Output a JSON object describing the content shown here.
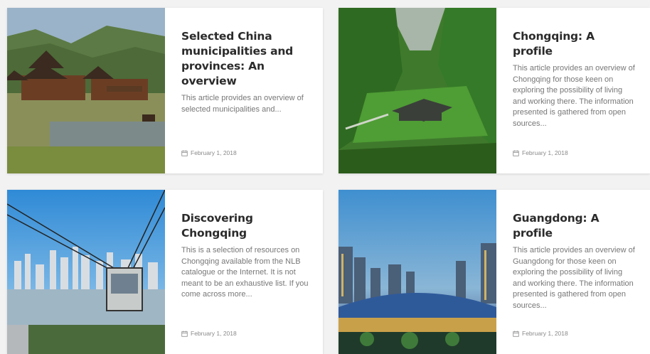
{
  "cards": [
    {
      "title": "Selected China municipalities and provinces: An overview",
      "excerpt": "This article provides an overview of selected municipalities and...",
      "date": "February 1, 2018",
      "image": "dong-village-wind-rain-bridge-photo"
    },
    {
      "title": "Chongqing: A profile",
      "excerpt": "This article provides an overview of Chongqing for those keen on exploring the possibility of living and working there. The information presented is gathered from open sources...",
      "date": "February 1, 2018",
      "image": "wulong-karst-gorge-photo"
    },
    {
      "title": "Discovering Chongqing",
      "excerpt": "This is a selection of resources on Chongqing available from the NLB catalogue or the Internet. It is not meant to be an exhaustive list. If you come across more...",
      "date": "February 1, 2018",
      "image": "chongqing-cable-car-skyline-photo"
    },
    {
      "title": "Guangdong: A profile",
      "excerpt": "This article provides an overview of Guangdong for those keen on exploring the possibility of living and working there. The information presented is gathered from open sources...",
      "date": "February 1, 2018",
      "image": "guangzhou-night-skyline-photo"
    }
  ],
  "icons": {
    "date": "calendar-icon"
  },
  "colors": {
    "background": "#f2f2f2",
    "card": "#ffffff",
    "title": "#2b2b2b",
    "text": "#777777",
    "meta": "#8a8a8a"
  }
}
